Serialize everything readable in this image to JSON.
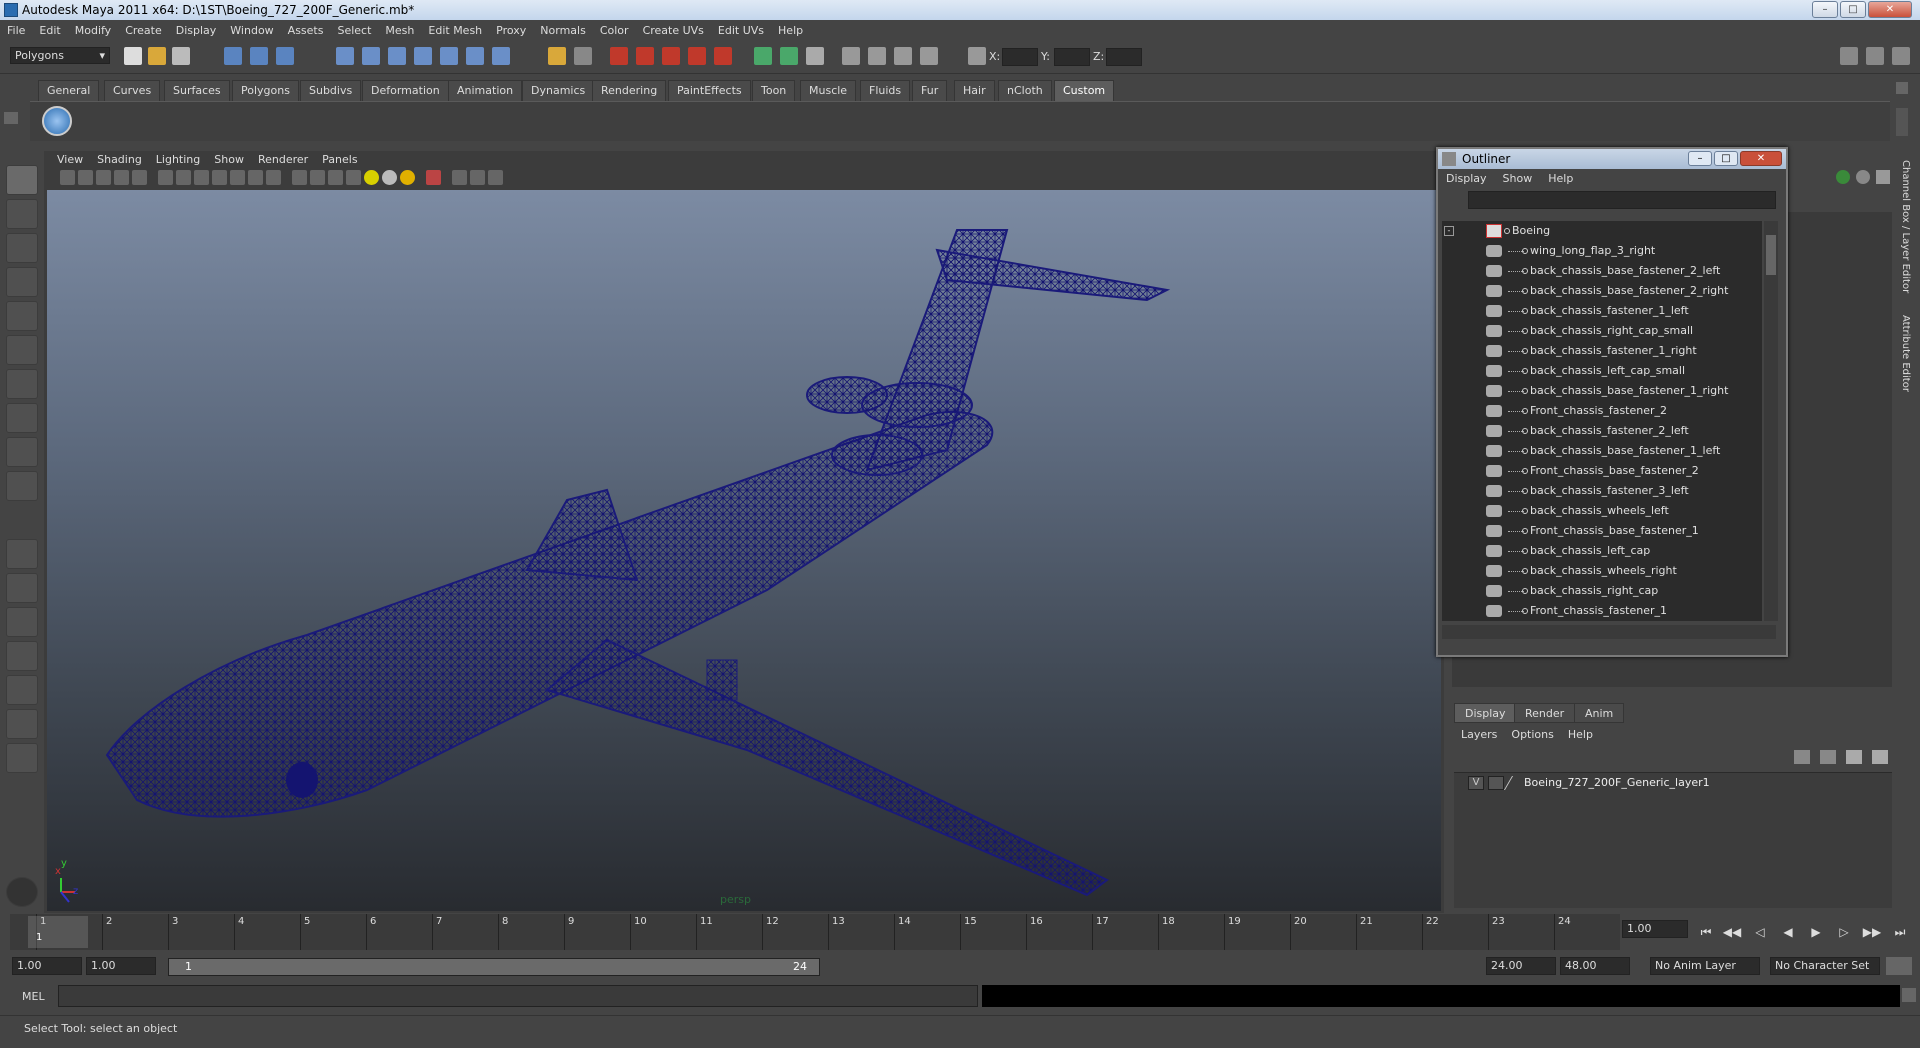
{
  "window": {
    "title": "Autodesk Maya 2011 x64: D:\\1ST\\Boeing_727_200F_Generic.mb*"
  },
  "menubar": [
    "File",
    "Edit",
    "Modify",
    "Create",
    "Display",
    "Window",
    "Assets",
    "Select",
    "Mesh",
    "Edit Mesh",
    "Proxy",
    "Normals",
    "Color",
    "Create UVs",
    "Edit UVs",
    "Help"
  ],
  "status_line": {
    "mode": "Polygons",
    "x_label": "X:",
    "y_label": "Y:",
    "z_label": "Z:"
  },
  "shelf_tabs": [
    "General",
    "Curves",
    "Surfaces",
    "Polygons",
    "Subdivs",
    "Deformation",
    "Animation",
    "Dynamics",
    "Rendering",
    "PaintEffects",
    "Toon",
    "Muscle",
    "Fluids",
    "Fur",
    "Hair",
    "nCloth",
    "Custom"
  ],
  "shelf_active": "Custom",
  "viewport": {
    "menu": [
      "View",
      "Shading",
      "Lighting",
      "Show",
      "Renderer",
      "Panels"
    ],
    "camera_label": "persp",
    "axis_labels": [
      "x",
      "y",
      "z"
    ],
    "wire_color": "#1a1a7a"
  },
  "outliner": {
    "title": "Outliner",
    "menu": [
      "Display",
      "Show",
      "Help"
    ],
    "root": "Boeing",
    "items": [
      "wing_long_flap_3_right",
      "back_chassis_base_fastener_2_left",
      "back_chassis_base_fastener_2_right",
      "back_chassis_fastener_1_left",
      "back_chassis_right_cap_small",
      "back_chassis_fastener_1_right",
      "back_chassis_left_cap_small",
      "back_chassis_base_fastener_1_right",
      "Front_chassis_fastener_2",
      "back_chassis_fastener_2_left",
      "back_chassis_base_fastener_1_left",
      "Front_chassis_base_fastener_2",
      "back_chassis_fastener_3_left",
      "back_chassis_wheels_left",
      "Front_chassis_base_fastener_1",
      "back_chassis_left_cap",
      "back_chassis_wheels_right",
      "back_chassis_right_cap",
      "Front_chassis_fastener_1"
    ]
  },
  "side_tabs": [
    "Channel Box / Layer Editor",
    "Attribute Editor"
  ],
  "layer_editor": {
    "tabs": [
      "Display",
      "Render",
      "Anim"
    ],
    "active_tab": "Display",
    "menu": [
      "Layers",
      "Options",
      "Help"
    ],
    "layers": [
      {
        "visible": "V",
        "name": "Boeing_727_200F_Generic_layer1"
      }
    ]
  },
  "time_slider": {
    "ticks": [
      "1",
      "2",
      "3",
      "4",
      "5",
      "6",
      "7",
      "8",
      "9",
      "10",
      "11",
      "12",
      "13",
      "14",
      "15",
      "16",
      "17",
      "18",
      "19",
      "20",
      "21",
      "22",
      "23",
      "24"
    ],
    "current_marker": "1",
    "current_time": "1.00"
  },
  "range": {
    "start": "1.00",
    "playback_start": "1.00",
    "slider_start": "1",
    "slider_end": "24",
    "playback_end": "24.00",
    "end": "48.00",
    "anim_layer": "No Anim Layer",
    "character_set": "No Character Set"
  },
  "mel": {
    "label": "MEL"
  },
  "help_line": "Select Tool: select an object"
}
